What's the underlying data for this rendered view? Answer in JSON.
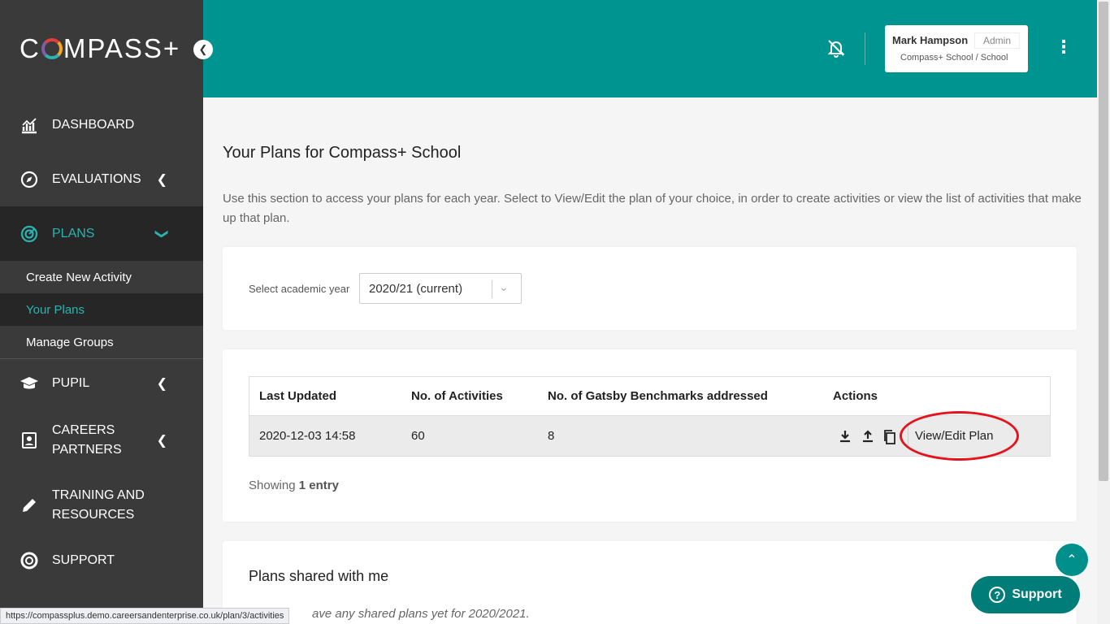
{
  "brand": {
    "logo_text_left": "C",
    "logo_text_right": "MPASS+"
  },
  "sidebar": {
    "items": [
      {
        "label": "DASHBOARD",
        "icon": "chart-icon"
      },
      {
        "label": "EVALUATIONS",
        "icon": "compass-icon"
      },
      {
        "label": "PLANS",
        "icon": "target-icon"
      },
      {
        "label": "PUPIL",
        "icon": "graduation-cap-icon"
      },
      {
        "label": "CAREERS",
        "label2": "PARTNERS",
        "icon": "contact-card-icon"
      },
      {
        "label": "TRAINING AND",
        "label2": "RESOURCES",
        "icon": "pencil-icon"
      },
      {
        "label": "SUPPORT",
        "icon": "lifebuoy-icon"
      }
    ],
    "sub_items": [
      {
        "label": "Create New Activity"
      },
      {
        "label": "Your Plans"
      },
      {
        "label": "Manage Groups"
      }
    ]
  },
  "user": {
    "name": "Mark Hampson",
    "role": "Admin",
    "org": "Compass+ School",
    "org_type": "/ School"
  },
  "page": {
    "title": "Your Plans for Compass+ School",
    "description": "Use this section to access your plans for each year. Select to View/Edit the plan of your choice, in order to create activities or view the list of activities that make up that plan."
  },
  "filter": {
    "label": "Select academic year",
    "value": "2020/21 (current)"
  },
  "table": {
    "headers": [
      "Last Updated",
      "No. of Activities",
      "No. of Gatsby Benchmarks addressed",
      "Actions"
    ],
    "rows": [
      {
        "last_updated": "2020-12-03 14:58",
        "activities": "60",
        "benchmarks": "8",
        "action_label": "View/Edit Plan"
      }
    ],
    "showing_prefix": "Showing",
    "showing_count": "1 entry"
  },
  "shared": {
    "title": "Plans shared with me",
    "message": "ave any shared plans yet for 2020/2021."
  },
  "support_label": "Support",
  "status_url": "https://compassplus.demo.careersandenterprise.co.uk/plan/3/activities",
  "colors": {
    "teal": "#009490",
    "sidebar": "#3a3a3a",
    "highlight": "#e3141e"
  }
}
